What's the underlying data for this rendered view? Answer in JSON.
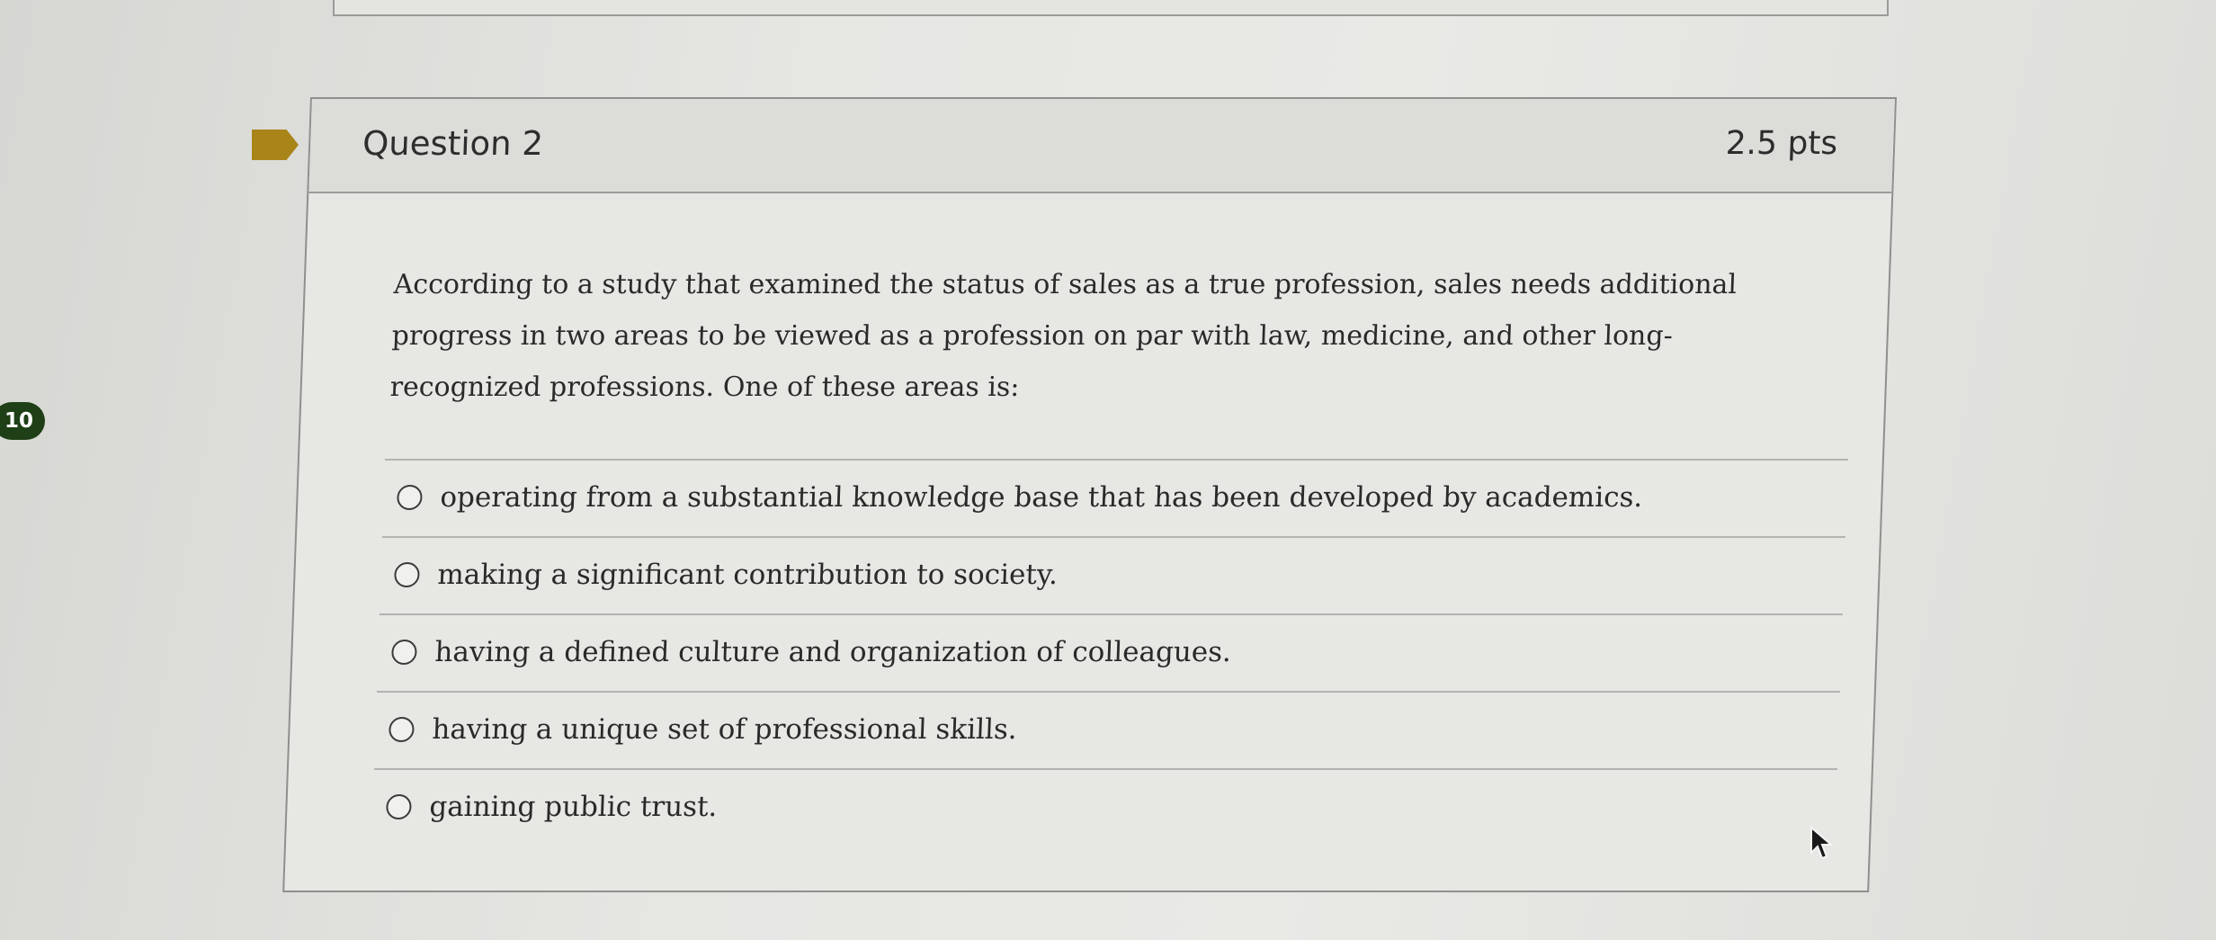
{
  "side_badge": "10",
  "question": {
    "title": "Question 2",
    "points": "2.5 pts",
    "text": "According to a study that examined the status of sales as a true profession, sales needs additional progress in two areas to be viewed as a profession on par with law, medicine, and other long-recognized professions. One of these areas is:",
    "answers": [
      {
        "label": "operating from a substantial knowledge base that has been developed by academics.",
        "selected": false
      },
      {
        "label": "making a significant contribution to society.",
        "selected": false
      },
      {
        "label": "having a defined culture and organization of colleagues.",
        "selected": false
      },
      {
        "label": "having a unique set of professional skills.",
        "selected": false
      },
      {
        "label": "gaining public trust.",
        "selected": false
      }
    ]
  },
  "icons": {
    "flag": "bookmark-flag-icon",
    "cursor": "mouse-pointer-icon"
  },
  "colors": {
    "flag": "#a98419",
    "badge": "#1f3f16",
    "header_background": "#dcdcd9",
    "card_border": "#8f8f8d"
  }
}
